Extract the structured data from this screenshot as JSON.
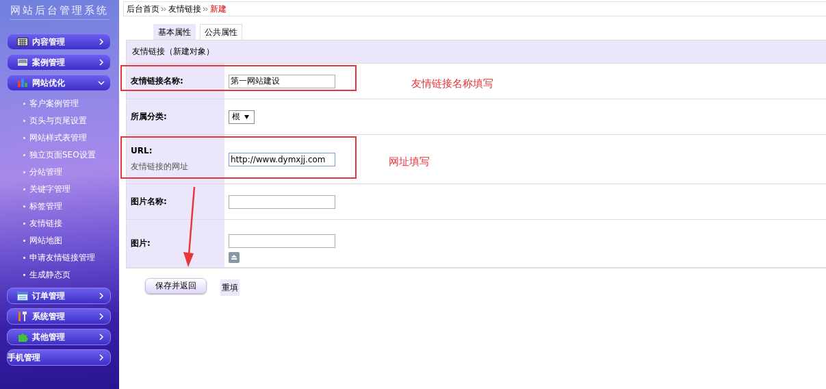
{
  "sidebar": {
    "title": "网站后台管理系统",
    "menu": [
      {
        "label": "内容管理",
        "kind": "grid",
        "expanded": false
      },
      {
        "label": "案例管理",
        "kind": "tray",
        "expanded": false
      },
      {
        "label": "网站优化",
        "kind": "bars",
        "expanded": true,
        "children": [
          "客户案例管理",
          "页头与页尾设置",
          "网站样式表管理",
          "独立页面SEO设置",
          "分站管理",
          "关键字管理",
          "标签管理",
          "友情链接",
          "网站地图",
          "申请友情链接管理",
          "生成静态页"
        ]
      },
      {
        "label": "订单管理",
        "kind": "window",
        "expanded": false
      },
      {
        "label": "系统管理",
        "kind": "tools",
        "expanded": false
      },
      {
        "label": "其他管理",
        "kind": "puzzle",
        "expanded": false
      },
      {
        "label": "手机管理",
        "kind": "plain",
        "expanded": false
      }
    ]
  },
  "breadcrumb": [
    {
      "label": "后台首页",
      "current": false
    },
    {
      "label": "友情链接",
      "current": false
    },
    {
      "label": "新建",
      "current": true
    }
  ],
  "tabs": [
    {
      "label": "基本属性",
      "selected": true
    },
    {
      "label": "公共属性",
      "selected": false
    }
  ],
  "form": {
    "title": "友情链接（新建对象）",
    "fields": [
      {
        "kind": "text",
        "label": "友情链接名称:",
        "value": "第一网站建设",
        "highlighted": true,
        "note": "友情链接名称填写"
      },
      {
        "kind": "select",
        "label": "所属分类:",
        "value": "根",
        "highlighted": false
      },
      {
        "kind": "text",
        "label": "URL:",
        "hint": "友情链接的网址",
        "value": "http://www.dymxjj.com",
        "highlighted": true,
        "note": "网址填写"
      },
      {
        "kind": "text",
        "label": "图片名称:",
        "highlighted": false
      },
      {
        "kind": "file",
        "label": "图片:",
        "highlighted": false
      }
    ]
  },
  "buttons": [
    {
      "label": "保存并返回",
      "kind": "primary"
    },
    {
      "label": "重填",
      "kind": "plain"
    }
  ]
}
